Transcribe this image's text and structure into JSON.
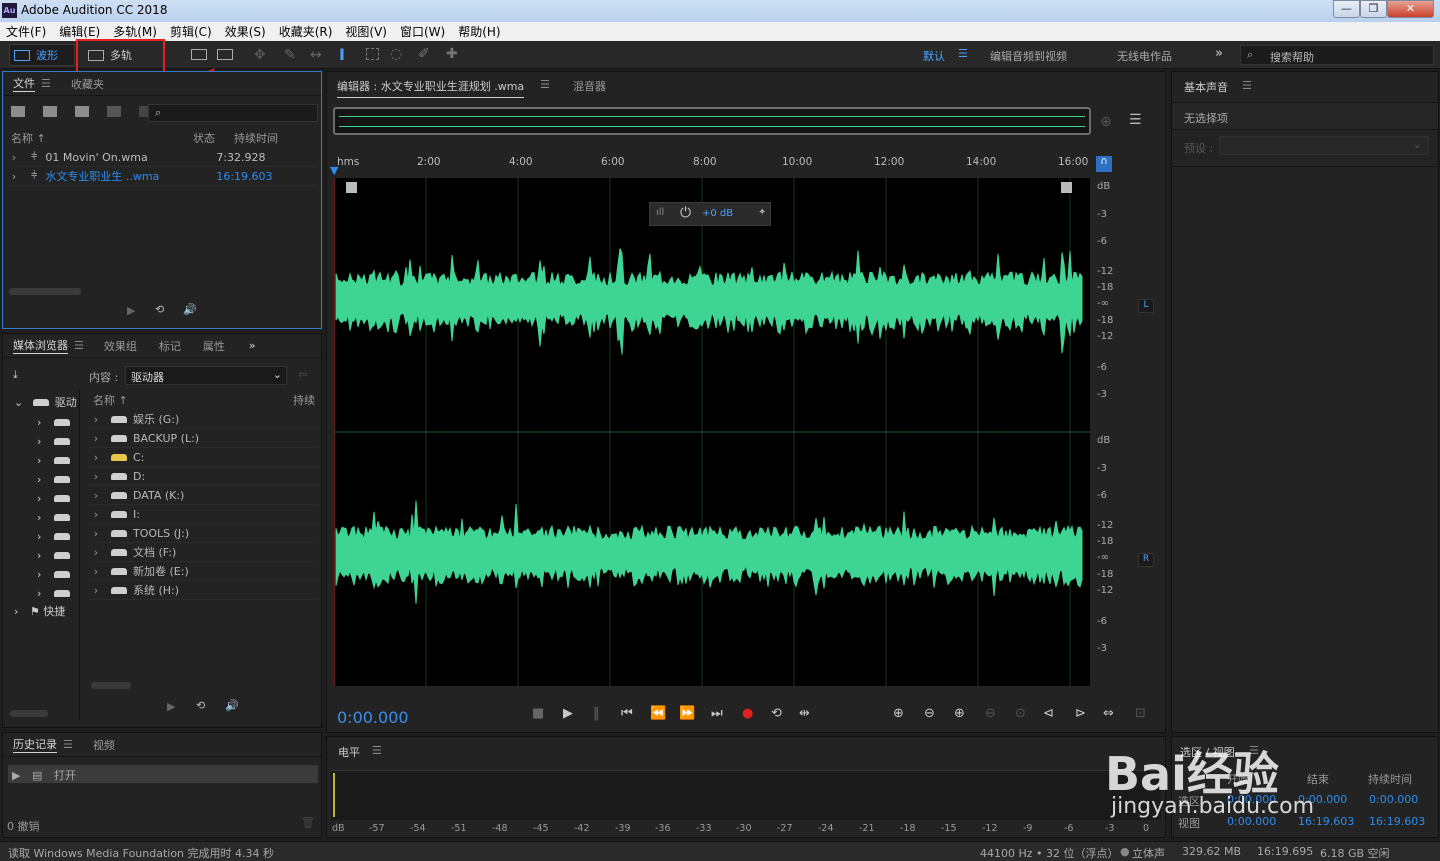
{
  "titlebar": {
    "app_icon": "Au",
    "title": "Adobe Audition CC 2018",
    "minimize": "—",
    "restore": "❐",
    "close": "✕"
  },
  "menu": [
    "文件(F)",
    "编辑(E)",
    "多轨(M)",
    "剪辑(C)",
    "效果(S)",
    "收藏夹(R)",
    "视图(V)",
    "窗口(W)",
    "帮助(H)"
  ],
  "toolbar": {
    "waveform_label": "波形",
    "multitrack_label": "多轨",
    "workspace_default": "默认",
    "workspace_edit_video": "编辑音频到视频",
    "workspace_radio": "无线电作品",
    "more": "»",
    "search_placeholder": "搜索帮助"
  },
  "files_panel": {
    "tab_files": "文件",
    "tab_favorites": "收藏夹",
    "col_name": "名称 ↑",
    "col_status": "状态",
    "col_duration": "持续时间",
    "items": [
      {
        "name": "01 Movin' On.wma",
        "duration": "7:32.928",
        "active": false
      },
      {
        "name": "水文专业职业生 ..wma",
        "duration": "16:19.603",
        "active": true
      }
    ]
  },
  "media_panel": {
    "tabs": [
      "媒体浏览器",
      "效果组",
      "标记",
      "属性"
    ],
    "content_label": "内容 :",
    "content_value": "驱动器",
    "col_name": "名称 ↑",
    "col_duration": "持续",
    "tree_root": "驱动",
    "tree_shortcut": "快捷",
    "drives": [
      "娱乐 (G:)",
      "BACKUP (L:)",
      "C:",
      "D:",
      "DATA (K:)",
      "I:",
      "TOOLS (J:)",
      "文档 (F:)",
      "新加卷 (E:)",
      "系统 (H:)"
    ]
  },
  "history_panel": {
    "tab_history": "历史记录",
    "tab_video": "视频",
    "open_item": "打开",
    "undo_count": "0 撤销"
  },
  "editor": {
    "tab_editor": "编辑器 : 水文专业职业生涯规划 .wma",
    "tab_mixer": "混音器",
    "hud_gain": "+0 dB",
    "time": "0:00.000",
    "ruler": [
      "hms",
      "2:00",
      "4:00",
      "6:00",
      "8:00",
      "10:00",
      "12:00",
      "14:00",
      "16:00"
    ],
    "db_scale": [
      "dB",
      "-3",
      "-6",
      "-12",
      "-18",
      "-∞",
      "-18",
      "-12",
      "-6",
      "-3"
    ],
    "channel_left": "L",
    "channel_right": "R"
  },
  "level_panel": {
    "title": "电平",
    "scale": [
      "dB",
      "-57",
      "-54",
      "-51",
      "-48",
      "-45",
      "-42",
      "-39",
      "-36",
      "-33",
      "-30",
      "-27",
      "-24",
      "-21",
      "-18",
      "-15",
      "-12",
      "-9",
      "-6",
      "-3",
      "0"
    ]
  },
  "essential_sound": {
    "title": "基本声音",
    "no_selection": "无选择项",
    "preset_label": "预设 :"
  },
  "selection_panel": {
    "title": "选区 / 视图",
    "col_start": "开始",
    "col_end": "结束",
    "col_duration": "持续时间",
    "row_selection": {
      "label": "选区",
      "start": "0:00.000",
      "end": "0:00.000",
      "duration": "0:00.000"
    },
    "row_view": {
      "label": "视图",
      "start": "0:00.000",
      "end": "16:19.603",
      "duration": "16:19.603"
    }
  },
  "status": {
    "message": "读取 Windows Media Foundation 完成用时 4.34 秒",
    "format": "44100 Hz • 32 位（浮点）",
    "channels": "立体声",
    "file_size": "329.62 MB",
    "duration": "16:19.695",
    "free_space": "6.18 GB 空闲"
  },
  "watermark": {
    "brand": "Bai经验",
    "url": "jingyan.baidu.com"
  },
  "colors": {
    "waveform": "#3ed494",
    "accent_blue": "#2d8ceb",
    "highlight_red": "#e82020",
    "record": "#e02020"
  }
}
